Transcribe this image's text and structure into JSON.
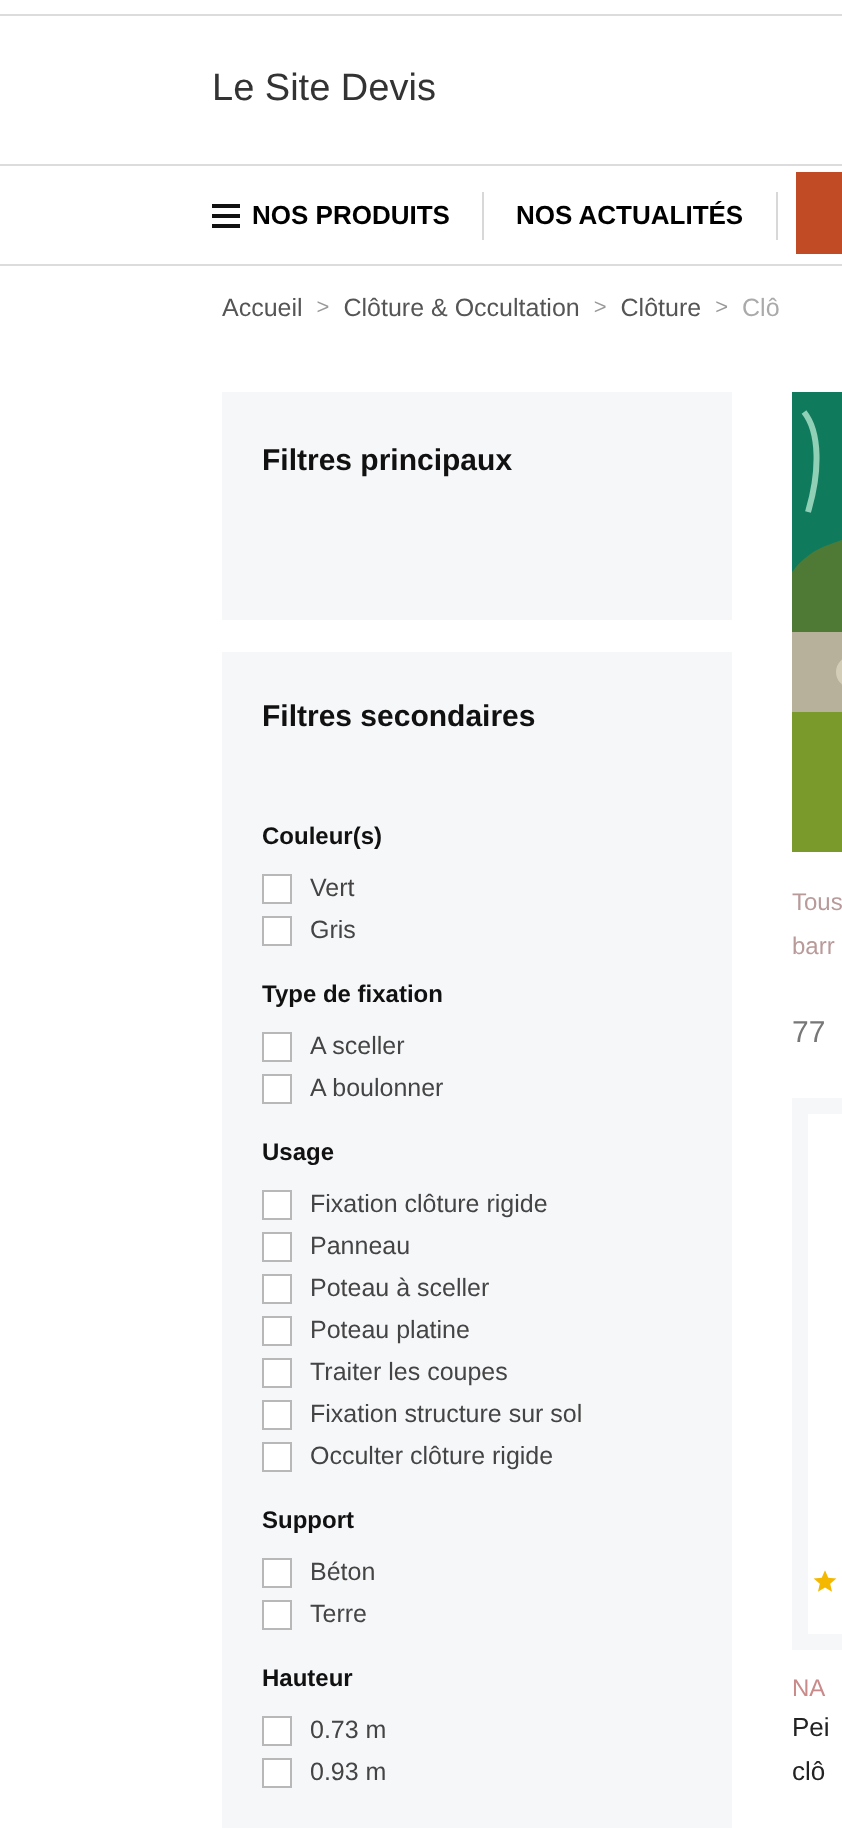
{
  "header": {
    "site_name": "Le Site Devis"
  },
  "nav": {
    "items": [
      {
        "label": "NOS PRODUITS",
        "kind": "menu"
      },
      {
        "label": "NOS ACTUALITÉS",
        "kind": "link"
      }
    ]
  },
  "breadcrumb": {
    "separator": ">",
    "items": [
      "Accueil",
      "Clôture & Occultation",
      "Clôture",
      "Clô"
    ]
  },
  "main_filters": {
    "title": "Filtres principaux"
  },
  "secondary_filters": {
    "title": "Filtres secondaires",
    "groups": [
      {
        "title": "Couleur(s)",
        "options": [
          {
            "label": "Vert",
            "checked": false
          },
          {
            "label": "Gris",
            "checked": false
          }
        ]
      },
      {
        "title": "Type de fixation",
        "options": [
          {
            "label": "A sceller",
            "checked": false
          },
          {
            "label": "A boulonner",
            "checked": false
          }
        ]
      },
      {
        "title": "Usage",
        "options": [
          {
            "label": "Fixation clôture rigide",
            "checked": false
          },
          {
            "label": "Panneau",
            "checked": false
          },
          {
            "label": "Poteau à sceller",
            "checked": false
          },
          {
            "label": "Poteau platine",
            "checked": false
          },
          {
            "label": "Traiter les coupes",
            "checked": false
          },
          {
            "label": "Fixation structure sur sol",
            "checked": false
          },
          {
            "label": "Occulter clôture rigide",
            "checked": false
          }
        ]
      },
      {
        "title": "Support",
        "options": [
          {
            "label": "Béton",
            "checked": false
          },
          {
            "label": "Terre",
            "checked": false
          }
        ]
      },
      {
        "title": "Hauteur",
        "options": [
          {
            "label": "0.73 m",
            "checked": false
          },
          {
            "label": "0.93 m",
            "checked": false
          }
        ]
      }
    ]
  },
  "category": {
    "description_lines": [
      "Tous",
      "barr"
    ],
    "count": "77"
  },
  "product": {
    "brand": "NA",
    "name_lines": [
      "Pei",
      "clô"
    ]
  }
}
